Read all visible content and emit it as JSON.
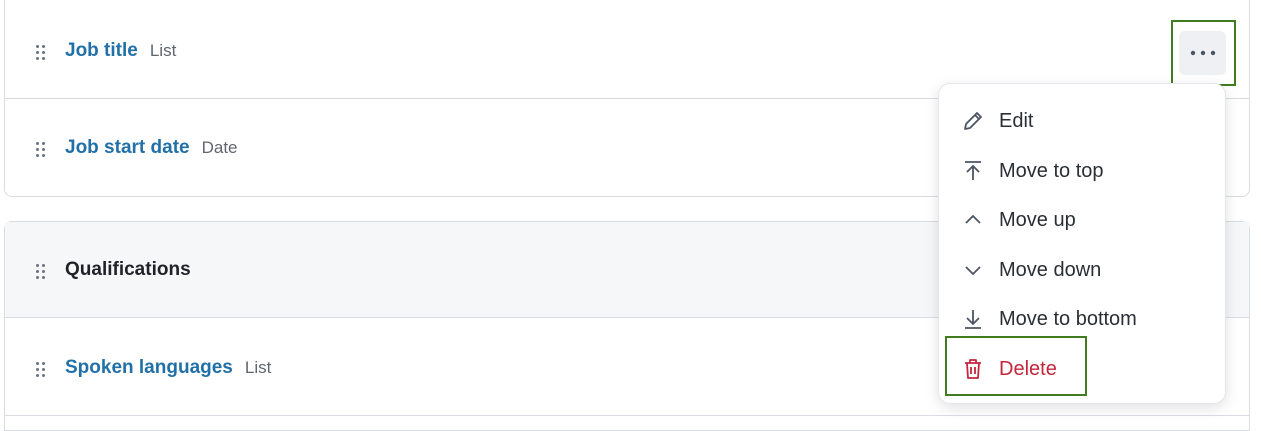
{
  "fields_top": [
    {
      "name": "Job title",
      "type": "List"
    },
    {
      "name": "Job start date",
      "type": "Date"
    }
  ],
  "group": {
    "name": "Qualifications"
  },
  "fields_bottom": [
    {
      "name": "Spoken languages",
      "type": "List"
    }
  ],
  "menu": {
    "items": [
      {
        "label": "Edit",
        "icon": "pencil-icon"
      },
      {
        "label": "Move to top",
        "icon": "arrow-to-top-icon"
      },
      {
        "label": "Move up",
        "icon": "chevron-up-icon"
      },
      {
        "label": "Move down",
        "icon": "chevron-down-icon"
      },
      {
        "label": "Move to bottom",
        "icon": "arrow-to-bottom-icon"
      },
      {
        "label": "Delete",
        "icon": "trash-icon"
      }
    ]
  },
  "colors": {
    "link": "#2270a8",
    "danger": "#c4263c",
    "highlight": "#3f7d20"
  }
}
